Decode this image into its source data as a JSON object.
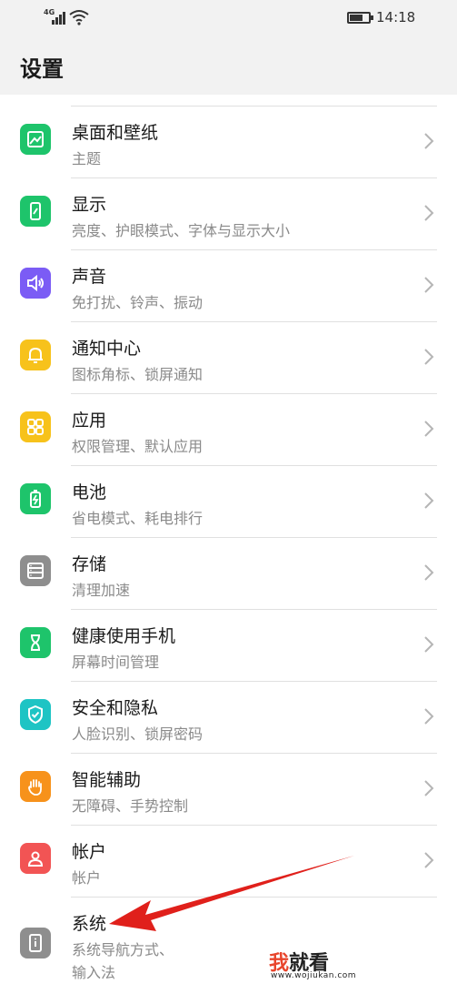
{
  "status_bar": {
    "network_label": "4G",
    "time": "14:18",
    "battery_level": 0.7
  },
  "header": {
    "title": "设置"
  },
  "settings": [
    {
      "label": "桌面和壁纸",
      "sub": "主题",
      "icon": "wallpaper-icon",
      "color": "#1ec46b"
    },
    {
      "label": "显示",
      "sub": "亮度、护眼模式、字体与显示大小",
      "icon": "display-icon",
      "color": "#1ec46b"
    },
    {
      "label": "声音",
      "sub": "免打扰、铃声、振动",
      "icon": "speaker-icon",
      "color": "#7b5cf5"
    },
    {
      "label": "通知中心",
      "sub": "图标角标、锁屏通知",
      "icon": "bell-icon",
      "color": "#f7c21b"
    },
    {
      "label": "应用",
      "sub": "权限管理、默认应用",
      "icon": "apps-grid-icon",
      "color": "#f7c21b"
    },
    {
      "label": "电池",
      "sub": "省电模式、耗电排行",
      "icon": "battery-icon",
      "color": "#1ec46b"
    },
    {
      "label": "存储",
      "sub": "清理加速",
      "icon": "storage-icon",
      "color": "#8e8e8e"
    },
    {
      "label": "健康使用手机",
      "sub": "屏幕时间管理",
      "icon": "hourglass-icon",
      "color": "#1ec46b"
    },
    {
      "label": "安全和隐私",
      "sub": "人脸识别、锁屏密码",
      "icon": "shield-icon",
      "color": "#1ec4c4"
    },
    {
      "label": "智能辅助",
      "sub": "无障碍、手势控制",
      "icon": "hand-icon",
      "color": "#f7921b"
    },
    {
      "label": "帐户",
      "sub": "帐户",
      "icon": "account-icon",
      "color": "#f25454"
    }
  ],
  "last_item": {
    "label": "系统",
    "sub": "系统导航方式、",
    "sub2": "输入法",
    "icon": "system-info-icon",
    "color": "#8e8e8e"
  },
  "watermark": {
    "part1": "我",
    "part2": "就看",
    "url": "www.wojiukan.com"
  }
}
